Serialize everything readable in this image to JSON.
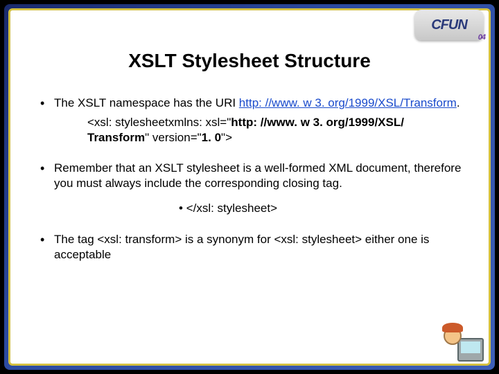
{
  "logo": {
    "brand": "CFUN",
    "sub": "04"
  },
  "title": "XSLT Stylesheet Structure",
  "bullets": {
    "b1_intro": "The XSLT namespace has the URI ",
    "b1_link": "http: //www. w 3. org/1999/XSL/Transform",
    "b1_period": ".",
    "b1_code_a": "<xsl: stylesheetxmlns: xsl=\"",
    "b1_code_b": "http: //www. w 3. org/1999/XSL/ Transform",
    "b1_code_c": "\" version=\"",
    "b1_code_d": "1. 0",
    "b1_code_e": "\">",
    "b2": "Remember that an XSLT stylesheet is a well-formed XML document, therefore you must always include the corresponding closing tag.",
    "b2_sub": "</xsl: stylesheet>",
    "b3": "The tag <xsl: transform> is a synonym  for <xsl: stylesheet> either one is acceptable"
  }
}
